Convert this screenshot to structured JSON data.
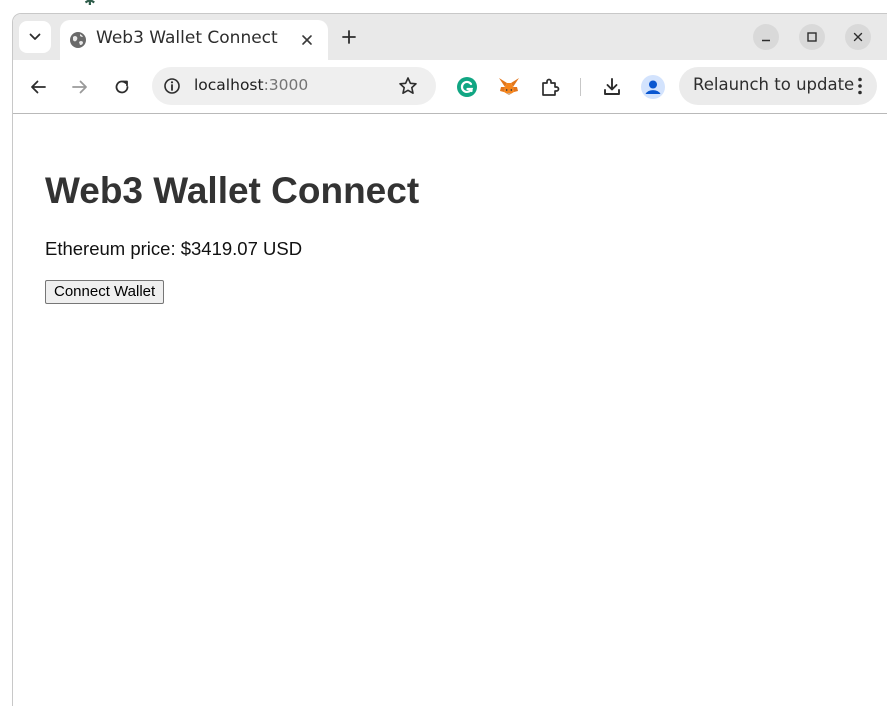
{
  "browser": {
    "tab": {
      "title": "Web3 Wallet Connect"
    },
    "address_bar": {
      "host": "localhost",
      "port": ":3000"
    },
    "relaunch_label": "Relaunch to update",
    "extensions": [
      "grammarly-icon",
      "metamask-fox-icon",
      "puzzle-piece-icon"
    ],
    "colors": {
      "tabstrip_bg": "#e9e9e9",
      "omnibox_bg": "#efefef",
      "grammarly_green": "#11a683",
      "profile_blue": "#0b57d0"
    }
  },
  "page": {
    "title": "Web3 Wallet Connect",
    "price_text": "Ethereum price: $3419.07 USD",
    "connect_button_label": "Connect Wallet"
  }
}
